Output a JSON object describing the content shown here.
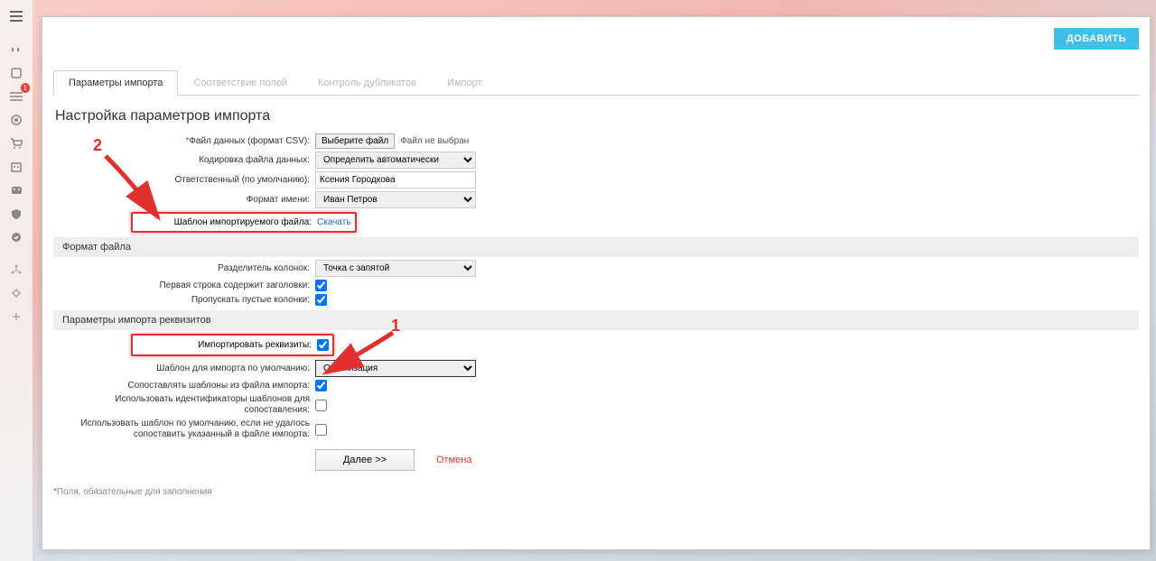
{
  "annotations": {
    "num1": "1",
    "num2": "2"
  },
  "header": {
    "add_button": "ДОБАВИТЬ"
  },
  "tabs": [
    {
      "label": "Параметры импорта",
      "active": true
    },
    {
      "label": "Соответствие полей",
      "active": false
    },
    {
      "label": "Контроль дубликатов",
      "active": false
    },
    {
      "label": "Импорт",
      "active": false
    }
  ],
  "page_title": "Настройка параметров импорта",
  "form": {
    "file_label": "Файл данных (формат CSV):",
    "file_button": "Выберите файл",
    "file_status": "Файл не выбран",
    "encoding_label": "Кодировка файла данных:",
    "encoding_value": "Определить автоматически",
    "responsible_label": "Ответственный (по умолчанию):",
    "responsible_value": "Ксения Городкова",
    "name_format_label": "Формат имени:",
    "name_format_value": "Иван Петров",
    "template_file_label": "Шаблон импортируемого файла:",
    "template_file_link": "Скачать"
  },
  "section1": {
    "title": "Формат файла",
    "sep_label": "Разделитель колонок:",
    "sep_value": "Точка с запятой",
    "first_row_label": "Первая строка содержит заголовки:",
    "first_row_checked": true,
    "skip_empty_label": "Пропускать пустые колонки:",
    "skip_empty_checked": true
  },
  "section2": {
    "title": "Параметры импорта реквизитов",
    "import_req_label": "Импортировать реквизиты:",
    "import_req_checked": true,
    "default_tpl_label": "Шаблон для импорта по умолчанию:",
    "default_tpl_value": "Организация",
    "match_label": "Сопоставлять шаблоны из файла импорта:",
    "match_checked": true,
    "use_ids_label": "Использовать идентификаторы шаблонов для сопоставления:",
    "use_ids_checked": false,
    "fallback_label": "Использовать шаблон по умолчанию, если не удалось сопоставить указанный в файле импорта:",
    "fallback_checked": false
  },
  "actions": {
    "next": "Далее >>",
    "cancel": "Отмена"
  },
  "footnote": "Поля, обязательные для заполнения",
  "sidebar": {
    "badge": "1"
  }
}
